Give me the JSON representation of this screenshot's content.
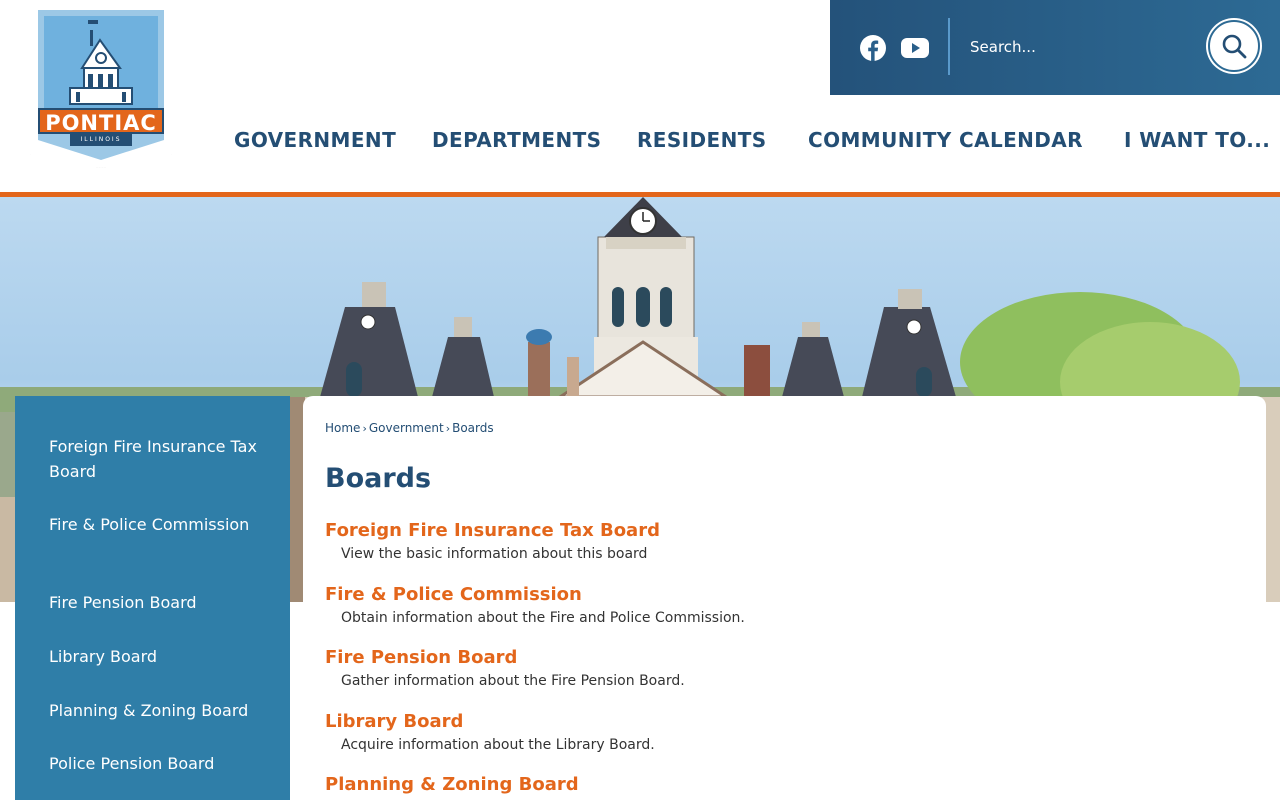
{
  "logo": {
    "name": "PONTIAC",
    "state": "ILLINOIS"
  },
  "header": {
    "social": [
      "facebook-icon",
      "youtube-icon"
    ],
    "search": {
      "placeholder": "Search..."
    },
    "nav": [
      {
        "label": "GOVERNMENT"
      },
      {
        "label": "DEPARTMENTS"
      },
      {
        "label": "RESIDENTS"
      },
      {
        "label": "COMMUNITY CALENDAR"
      },
      {
        "label": "I WANT TO..."
      }
    ]
  },
  "sidebar": {
    "items": [
      {
        "label": "Foreign Fire Insurance Tax Board"
      },
      {
        "label": "Fire & Police Commission"
      },
      {
        "label": "Fire Pension Board"
      },
      {
        "label": "Library Board"
      },
      {
        "label": "Planning & Zoning Board"
      },
      {
        "label": "Police Pension Board"
      }
    ]
  },
  "breadcrumb": [
    "Home",
    "Government",
    "Boards"
  ],
  "page_title": "Boards",
  "boards": [
    {
      "title": "Foreign Fire Insurance Tax Board",
      "desc": "View the basic information about this board"
    },
    {
      "title": "Fire & Police Commission",
      "desc": "Obtain information about the Fire and Police Commission."
    },
    {
      "title": "Fire Pension Board",
      "desc": "Gather information about the Fire Pension Board."
    },
    {
      "title": "Library Board",
      "desc": "Acquire information about the Library Board."
    },
    {
      "title": "Planning & Zoning Board",
      "desc": ""
    }
  ],
  "colors": {
    "brand_navy": "#244e74",
    "accent_orange": "#e3661b",
    "sidebar_blue": "#2f7ea8"
  }
}
